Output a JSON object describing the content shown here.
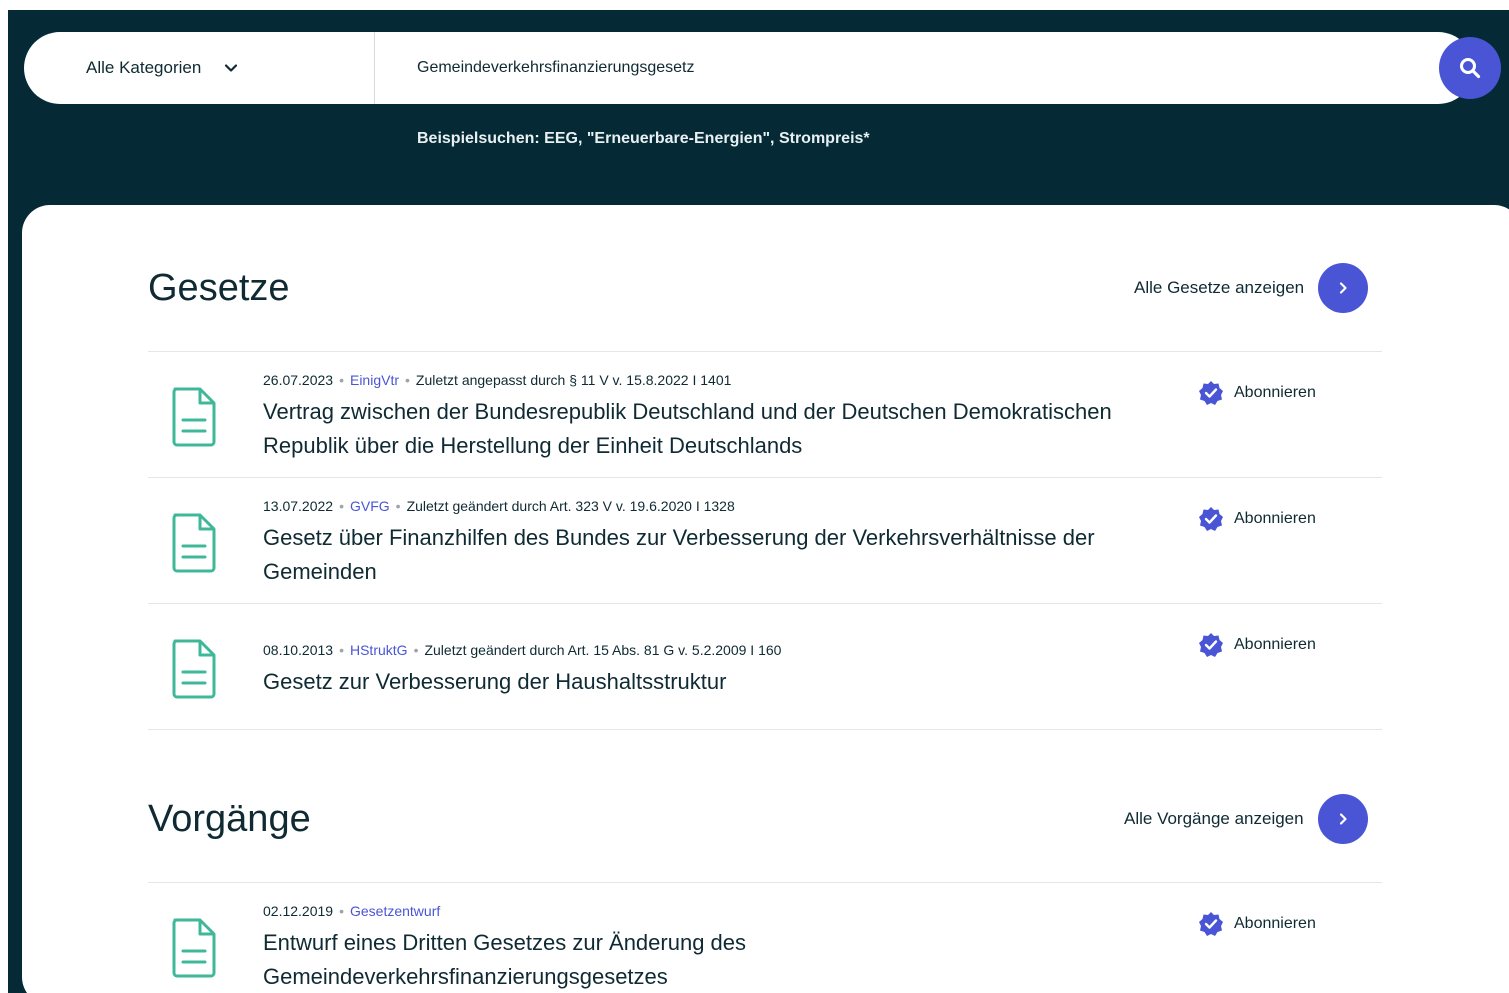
{
  "search": {
    "category_label": "Alle Kategorien",
    "query": "Gemeindeverkehrsfinanzierungsgesetz",
    "examples": "Beispielsuchen: EEG, \"Erneuerbare-Energien\", Strompreis*"
  },
  "sections": {
    "gesetze": {
      "title": "Gesetze",
      "all_link": "Alle Gesetze anzeigen",
      "items": [
        {
          "date": "26.07.2023",
          "abbr": "EinigVtr",
          "note": "Zuletzt angepasst durch § 11 V v. 15.8.2022 I 1401",
          "title": "Vertrag zwischen der Bundesrepublik Deutschland und der Deutschen Demokratischen Republik über die Herstellung der Einheit Deutschlands",
          "subscribe": "Abonnieren"
        },
        {
          "date": "13.07.2022",
          "abbr": "GVFG",
          "note": "Zuletzt geändert durch Art. 323 V v. 19.6.2020 I 1328",
          "title": "Gesetz über Finanzhilfen des Bundes zur Verbesserung der Verkehrsverhältnisse der Gemeinden",
          "subscribe": "Abonnieren"
        },
        {
          "date": "08.10.2013",
          "abbr": "HStruktG",
          "note": "Zuletzt geändert durch Art. 15 Abs. 81 G v. 5.2.2009 I 160",
          "title": "Gesetz zur Verbesserung der Haushaltsstruktur",
          "subscribe": "Abonnieren"
        }
      ]
    },
    "vorgaenge": {
      "title": "Vorgänge",
      "all_link": "Alle Vorgänge anzeigen",
      "items": [
        {
          "date": "02.12.2019",
          "abbr": "Gesetzentwurf",
          "title": "Entwurf eines Dritten Gesetzes zur Änderung des Gemeindeverkehrsfinanzierungsgesetzes",
          "subscribe": "Abonnieren"
        }
      ]
    }
  },
  "icons": {
    "search": "search-icon",
    "chevron": "chevron-down-icon",
    "arrow": "chevron-right-icon",
    "document": "document-icon",
    "verified": "verified-badge-icon"
  },
  "colors": {
    "header_bg": "#052a36",
    "accent": "#4a55d6",
    "doc_icon": "#3fb89a"
  }
}
